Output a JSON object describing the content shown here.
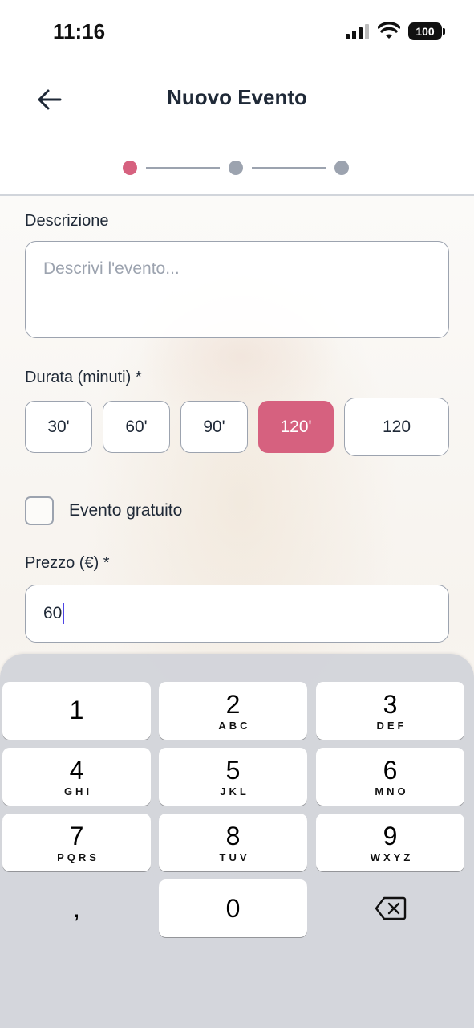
{
  "status_bar": {
    "time": "11:16",
    "battery": "100"
  },
  "header": {
    "title": "Nuovo Evento",
    "steps_total": 3,
    "current_step": 1
  },
  "form": {
    "description": {
      "label": "Descrizione",
      "placeholder": "Descrivi l'evento..."
    },
    "duration": {
      "label": "Durata (minuti) *",
      "options": [
        "30'",
        "60'",
        "90'",
        "120'"
      ],
      "selected": "120'",
      "custom_value": "120"
    },
    "free_event": {
      "label": "Evento gratuito",
      "checked": false
    },
    "price": {
      "label": "Prezzo (€) *",
      "value": "60"
    }
  },
  "keyboard": {
    "keys": [
      {
        "digit": "1",
        "letters": ""
      },
      {
        "digit": "2",
        "letters": "ABC"
      },
      {
        "digit": "3",
        "letters": "DEF"
      },
      {
        "digit": "4",
        "letters": "GHI"
      },
      {
        "digit": "5",
        "letters": "JKL"
      },
      {
        "digit": "6",
        "letters": "MNO"
      },
      {
        "digit": "7",
        "letters": "PQRS"
      },
      {
        "digit": "8",
        "letters": "TUV"
      },
      {
        "digit": "9",
        "letters": "WXYZ"
      },
      {
        "digit": ",",
        "letters": ""
      },
      {
        "digit": "0",
        "letters": ""
      }
    ]
  },
  "colors": {
    "accent": "#d6617f",
    "border": "#9ca3af",
    "text": "#1f2937"
  }
}
